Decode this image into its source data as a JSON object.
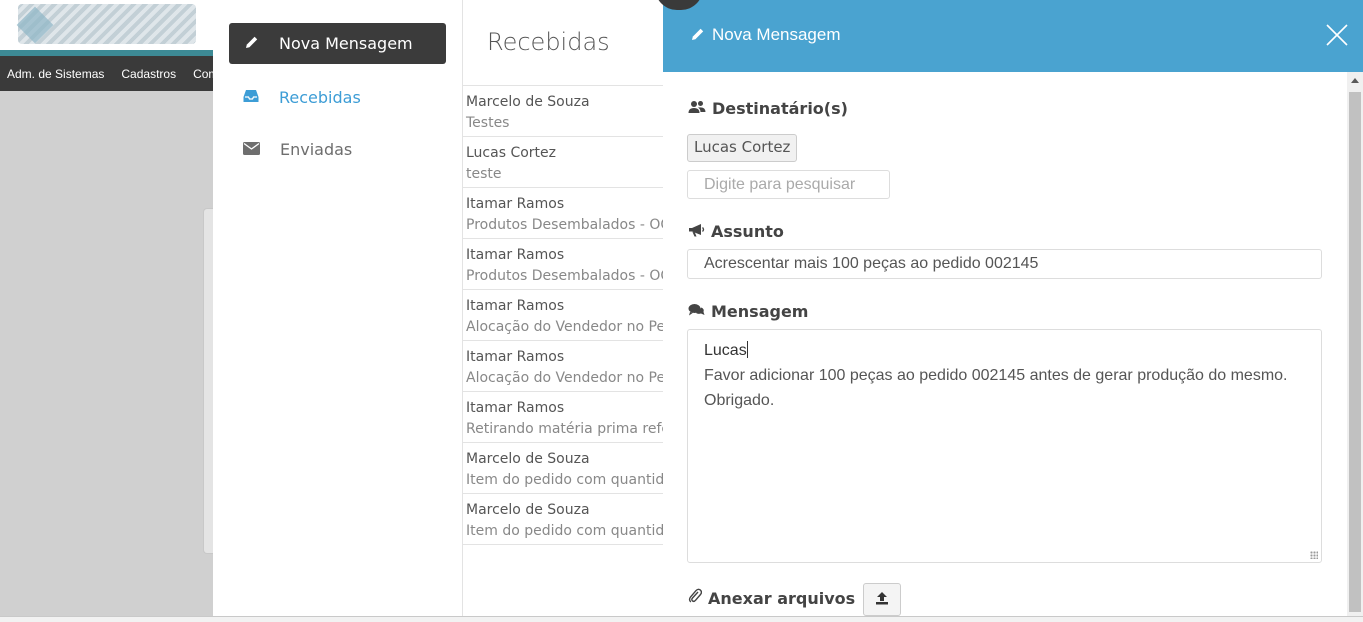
{
  "background_app": {
    "menu": [
      "Adm. de Sistemas",
      "Cadastros",
      "Com"
    ]
  },
  "mail": {
    "new_button_label": "Nova Mensagem",
    "nav": [
      {
        "label": "Recebidas",
        "icon": "inbox-icon",
        "active": true
      },
      {
        "label": "Enviadas",
        "icon": "envelope-icon",
        "active": false
      }
    ],
    "list_title": "Recebidas",
    "messages": [
      {
        "from": "Marcelo de Souza",
        "subject": "Testes"
      },
      {
        "from": "Lucas Cortez",
        "subject": "teste"
      },
      {
        "from": "Itamar Ramos",
        "subject": "Produtos Desembalados - OC"
      },
      {
        "from": "Itamar Ramos",
        "subject": "Produtos Desembalados - OC"
      },
      {
        "from": "Itamar Ramos",
        "subject": "Alocação do Vendedor no Pedido"
      },
      {
        "from": "Itamar Ramos",
        "subject": "Alocação do Vendedor no Pedido"
      },
      {
        "from": "Itamar Ramos",
        "subject": "Retirando matéria prima referente"
      },
      {
        "from": "Marcelo de Souza",
        "subject": "Item do pedido com quantidade"
      },
      {
        "from": "Marcelo de Souza",
        "subject": "Item do pedido com quantidade"
      }
    ]
  },
  "modal": {
    "title": "Nova Mensagem",
    "recipients_label": "Destinatário(s)",
    "recipients": [
      "Lucas Cortez"
    ],
    "search_placeholder": "Digite para pesquisar",
    "subject_label": "Assunto",
    "subject_value": "Acrescentar mais 100 peças ao pedido 002145",
    "message_label": "Mensagem",
    "message_lines": [
      "Lucas",
      "Favor adicionar 100 peças ao pedido 002145 antes de gerar produção do mesmo.",
      "Obrigado."
    ],
    "attach_label": "Anexar arquivos"
  },
  "colors": {
    "modal_header": "#4aa3d0",
    "active_nav": "#3d9dd6",
    "dark_button": "#3b3b3b",
    "menu_bar": "#3a3a3a"
  }
}
